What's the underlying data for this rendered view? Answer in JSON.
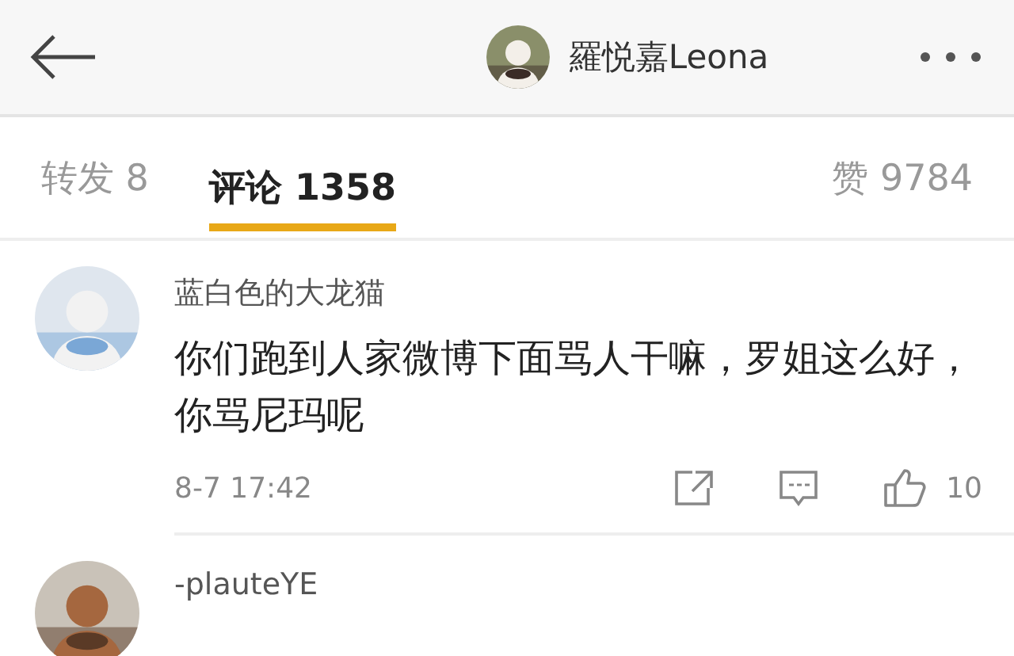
{
  "header": {
    "title": "羅悦嘉Leona"
  },
  "tabs": [
    {
      "label": "转发 8",
      "selected": false
    },
    {
      "label": "评论 1358",
      "selected": true
    },
    {
      "label": "赞 9784",
      "selected": false
    }
  ],
  "comments": [
    {
      "user": "蓝白色的大龙猫",
      "text": "你们跑到人家微博下面骂人干嘛，罗姐这么好，你骂尼玛呢",
      "time": "8-7 17:42",
      "likes": "10"
    },
    {
      "user": "-plauteYE"
    }
  ]
}
